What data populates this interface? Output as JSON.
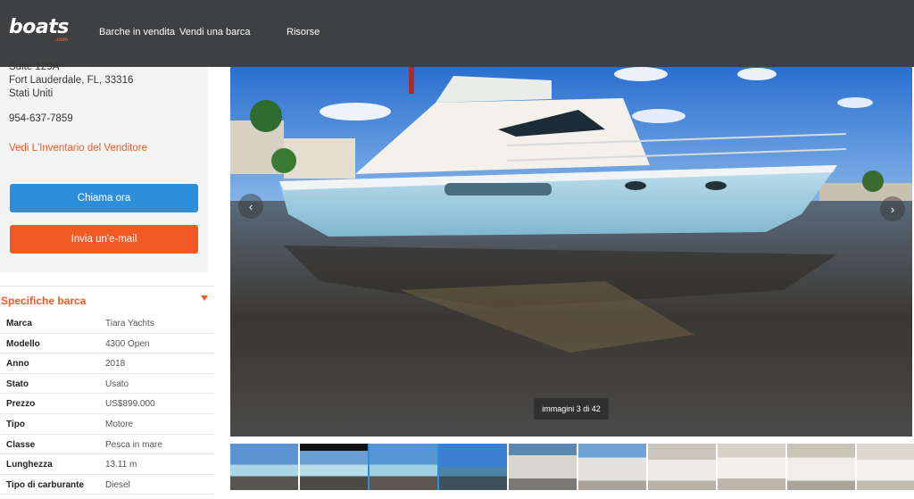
{
  "header": {
    "logo_text": "boats",
    "logo_sub": ".com",
    "nav": [
      "Barche in vendita",
      "Vendi una barca",
      "Risorse"
    ]
  },
  "seller": {
    "address_line_partial": "Suite 129A",
    "address_line_city": "Fort Lauderdale, FL, 33316",
    "address_line_country": "Stati Uniti",
    "phone": "954-637-7859",
    "inventory_link": "Vedi L'Inventario del Venditore",
    "call_button": "Chiama ora",
    "email_button": "Invia un'e-mail"
  },
  "specs": {
    "title": "Specifiche barca",
    "rows": [
      {
        "label": "Marca",
        "value": "Tiara Yachts"
      },
      {
        "label": "Modello",
        "value": "4300 Open"
      },
      {
        "label": "Anno",
        "value": "2018"
      },
      {
        "label": "Stato",
        "value": "Usato"
      },
      {
        "label": "Prezzo",
        "value": "US$899.000"
      },
      {
        "label": "Tipo",
        "value": "Motore"
      },
      {
        "label": "Classe",
        "value": "Pesca in mare"
      },
      {
        "label": "Lunghezza",
        "value": "13.11 m"
      },
      {
        "label": "Tipo di carburante",
        "value": "Diesel"
      }
    ]
  },
  "gallery": {
    "counter": "immagini 3 di 42",
    "prev_icon": "chevron-left-icon",
    "next_icon": "chevron-right-icon",
    "thumbnail_count": 10
  },
  "colors": {
    "header_bg": "#3f4041",
    "accent_orange": "#f15a24",
    "call_blue": "#2d8fdb",
    "sidebar_bg": "#f4f4f4"
  }
}
